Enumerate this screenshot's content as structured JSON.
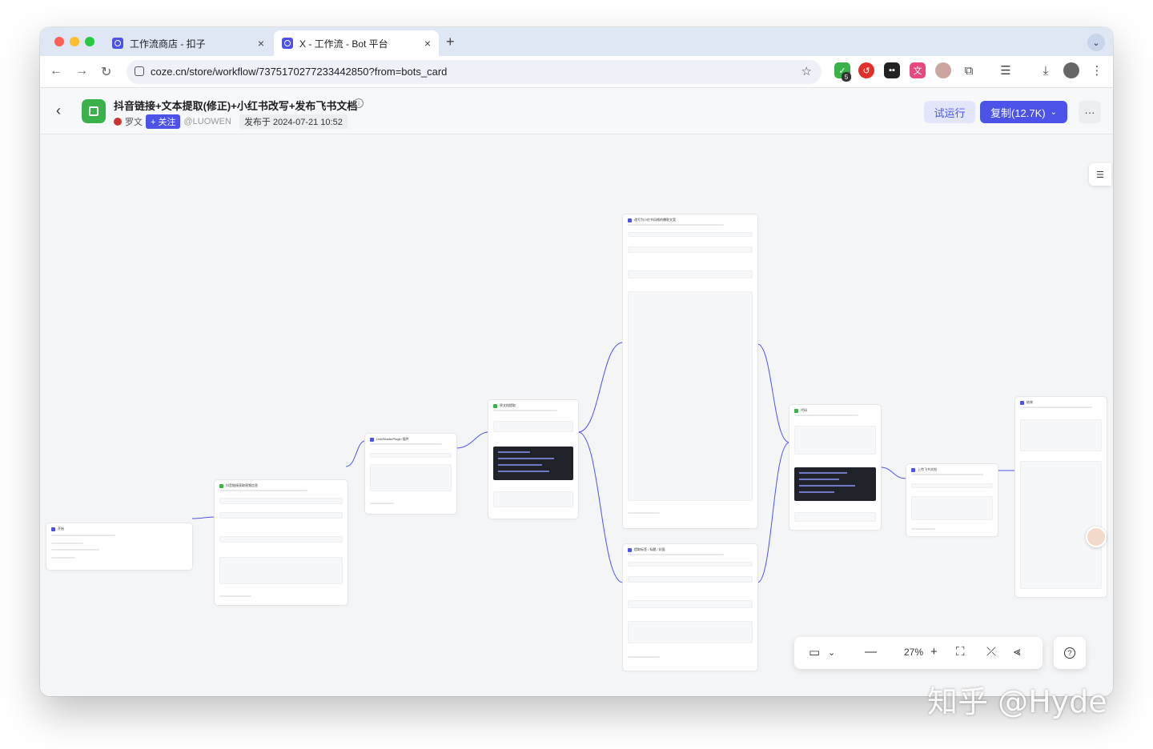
{
  "browser": {
    "tabs": [
      {
        "label": "工作流商店 - 扣子",
        "active": false
      },
      {
        "label": "X - 工作流 - Bot 平台",
        "active": true
      }
    ],
    "close_glyph": "×",
    "new_tab_glyph": "+",
    "url": "coze.cn/store/workflow/7375170277233442850?from=bots_card",
    "extension_badge": "5",
    "traffic_colors": [
      "#ff5f57",
      "#febc2e",
      "#28c840"
    ]
  },
  "header": {
    "back_glyph": "‹",
    "title": "抖音链接+文本提取(修正)+小红书改写+发布飞书文档",
    "author": "罗文",
    "follow_label": "+ 关注",
    "handle": "@LUOWEN",
    "published": "发布于 2024-07-21 10:52",
    "run_label": "试运行",
    "copy_label": "复制(12.7K)",
    "more_label": "···",
    "accent": "#4d53e8"
  },
  "canvas": {
    "nodes": [
      {
        "id": "start",
        "title": "开始",
        "color": "#4d53e8"
      },
      {
        "id": "douyin",
        "title": "抖音链接获取视频信息",
        "color": "#3bb14a"
      },
      {
        "id": "reader",
        "title": "LinkReaderPlugin 插件",
        "color": "#4d53e8"
      },
      {
        "id": "extract",
        "title": "原文档提取",
        "color": "#3bb14a"
      },
      {
        "id": "llm1",
        "title": "改写为小红书风格的爆款文案",
        "color": "#4d53e8"
      },
      {
        "id": "llm2",
        "title": "提取标签 / 标题 / 封面",
        "color": "#4d53e8"
      },
      {
        "id": "code",
        "title": "代码",
        "color": "#3bb14a"
      },
      {
        "id": "feishu",
        "title": "上传飞书文档",
        "color": "#4d53e8"
      },
      {
        "id": "end",
        "title": "结束",
        "color": "#4d53e8"
      }
    ]
  },
  "zoom": {
    "value": "27%",
    "minus": "—",
    "plus": "+"
  },
  "help_glyph": "?",
  "watermark": "知乎 @Hyde"
}
